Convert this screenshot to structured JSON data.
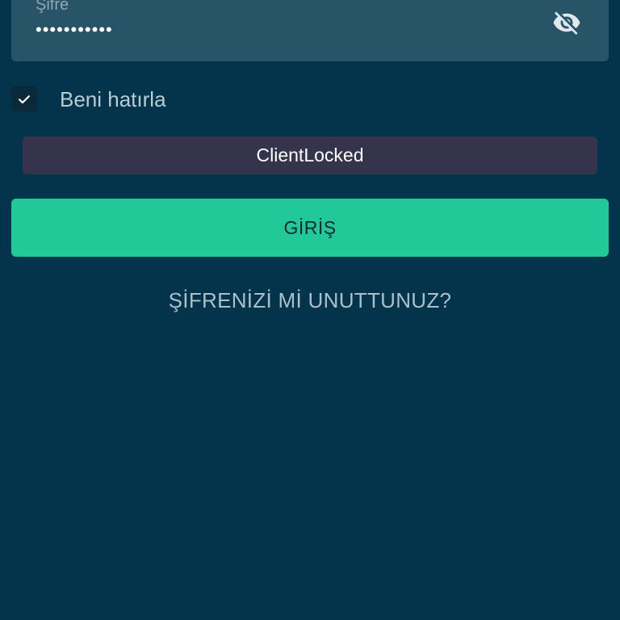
{
  "password_field": {
    "label": "Şifre",
    "masked_value": "•••••••••••",
    "visibility_icon": "eye-off-icon"
  },
  "remember_me": {
    "label": "Beni hatırla",
    "checked": true
  },
  "error_banner": {
    "message": "ClientLocked"
  },
  "login_button": {
    "label": "GİRİŞ"
  },
  "forgot_password": {
    "label": "ŞİFRENİZİ Mİ UNUTTUNUZ?"
  },
  "colors": {
    "background": "#04344b",
    "field_background": "#285467",
    "primary_button": "#21c999",
    "error_background": "#36334d"
  }
}
